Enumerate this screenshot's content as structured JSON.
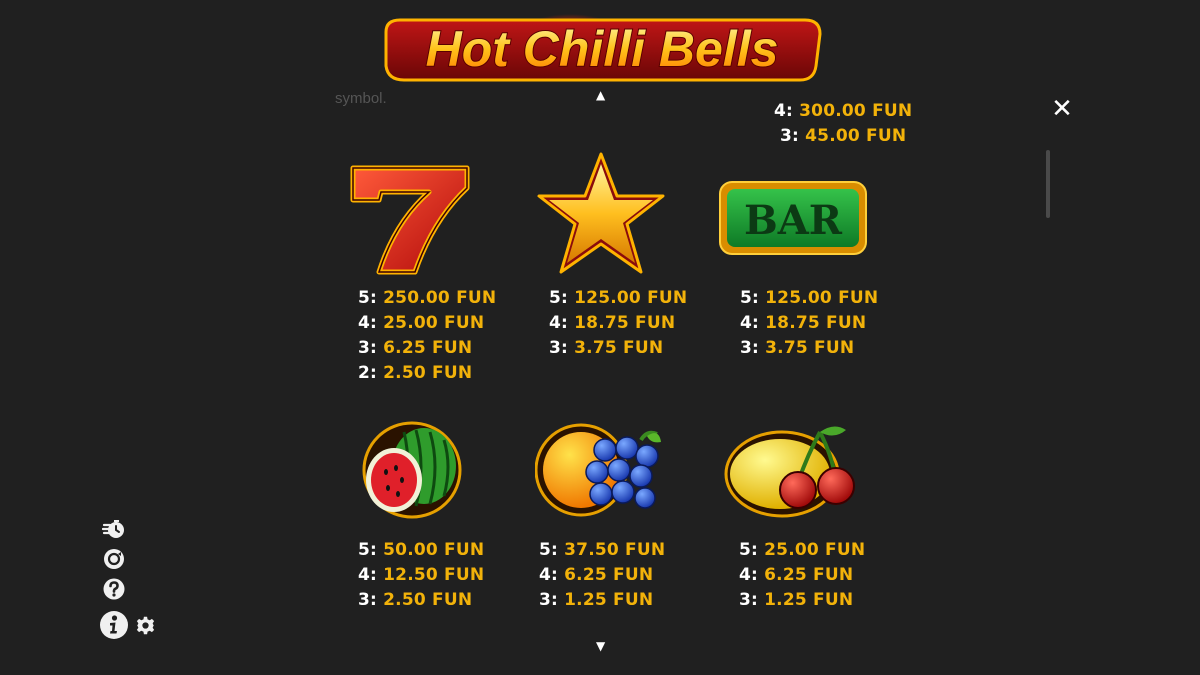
{
  "game_title": "Hot Chilli Bells",
  "partial_text": "symbol.",
  "currency": "FUN",
  "top_partial": [
    {
      "count": "4:",
      "amount": "300.00 FUN"
    },
    {
      "count": "3:",
      "amount": "45.00 FUN"
    }
  ],
  "symbols": [
    {
      "name": "seven",
      "payouts": [
        {
          "count": "5:",
          "amount": "250.00 FUN"
        },
        {
          "count": "4:",
          "amount": "25.00 FUN"
        },
        {
          "count": "3:",
          "amount": "6.25 FUN"
        },
        {
          "count": "2:",
          "amount": "2.50 FUN"
        }
      ]
    },
    {
      "name": "star",
      "payouts": [
        {
          "count": "5:",
          "amount": "125.00 FUN"
        },
        {
          "count": "4:",
          "amount": "18.75 FUN"
        },
        {
          "count": "3:",
          "amount": "3.75 FUN"
        }
      ]
    },
    {
      "name": "bar",
      "label": "BAR",
      "payouts": [
        {
          "count": "5:",
          "amount": "125.00 FUN"
        },
        {
          "count": "4:",
          "amount": "18.75 FUN"
        },
        {
          "count": "3:",
          "amount": "3.75 FUN"
        }
      ]
    },
    {
      "name": "watermelon",
      "payouts": [
        {
          "count": "5:",
          "amount": "50.00 FUN"
        },
        {
          "count": "4:",
          "amount": "12.50 FUN"
        },
        {
          "count": "3:",
          "amount": "2.50 FUN"
        }
      ]
    },
    {
      "name": "orange-grapes",
      "payouts": [
        {
          "count": "5:",
          "amount": "37.50 FUN"
        },
        {
          "count": "4:",
          "amount": "6.25 FUN"
        },
        {
          "count": "3:",
          "amount": "1.25 FUN"
        }
      ]
    },
    {
      "name": "lemon-cherries",
      "payouts": [
        {
          "count": "5:",
          "amount": "25.00 FUN"
        },
        {
          "count": "4:",
          "amount": "6.25 FUN"
        },
        {
          "count": "3:",
          "amount": "1.25 FUN"
        }
      ]
    }
  ],
  "controls": {
    "scroll_up": "▲",
    "scroll_down": "▼",
    "close": "✕"
  },
  "sidebar_icons": [
    "turbo-icon",
    "autoplay-icon",
    "help-icon",
    "info-icon",
    "settings-icon"
  ],
  "colors": {
    "background": "#202020",
    "payout_amount": "#f2b20a",
    "payout_count": "#ffffff"
  }
}
